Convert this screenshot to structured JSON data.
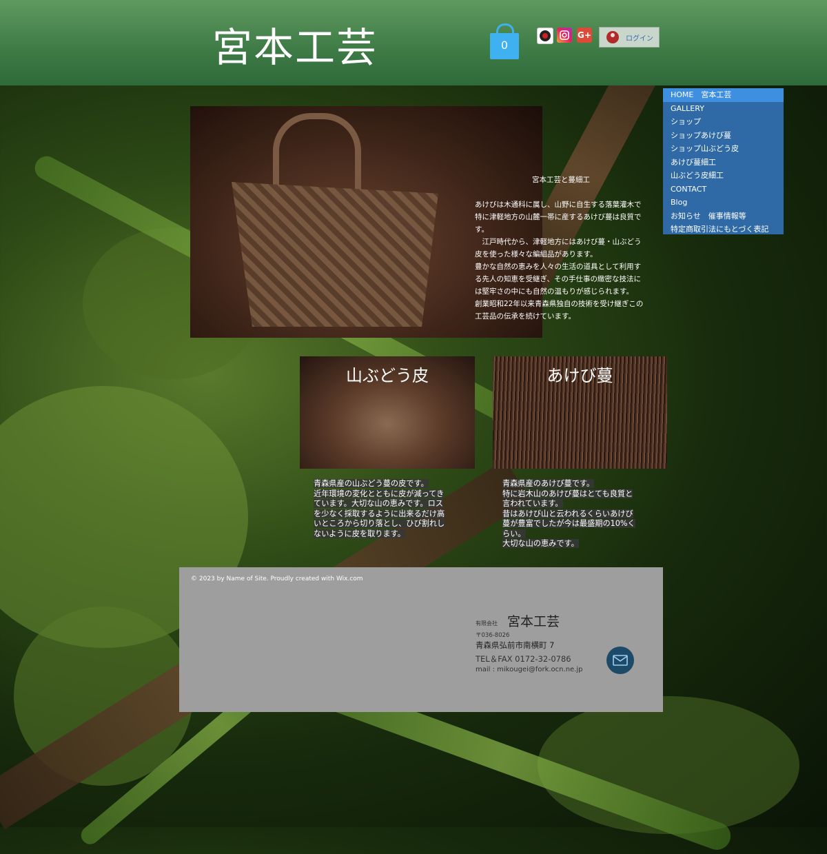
{
  "header": {
    "site_title": "宮本工芸",
    "cart_count": "0",
    "social_icons": [
      "blog-logo-icon",
      "instagram-icon",
      "google-plus-icon"
    ],
    "google_plus_label": "G+",
    "login_label": "ログイン"
  },
  "menu": {
    "items": [
      {
        "label": "HOME　宮本工芸",
        "active": true
      },
      {
        "label": "GALLERY"
      },
      {
        "label": "ショップ"
      },
      {
        "label": "ショップあけび蔓"
      },
      {
        "label": "ショップ山ぶどう皮"
      },
      {
        "label": "あけび蔓細工"
      },
      {
        "label": "山ぶどう皮細工"
      },
      {
        "label": "CONTACT"
      },
      {
        "label": "Blog"
      },
      {
        "label": "お知らせ　催事情報等"
      },
      {
        "label": "特定商取引法にもとづく表記"
      }
    ]
  },
  "intro": {
    "title": "宮本工芸と蔓細工",
    "paragraphs": [
      "あけびは木通科に属し、山野に自生する落葉灌木で特に津軽地方の山麓一帯に産するあけび蔓は良質です。",
      "　江戸時代から、津軽地方にはあけび蔓・山ぶどう皮を使った様々な編組品があります。",
      "豊かな自然の恵みを人々の生活の道具として利用する先人の知恵を受継ぎ、その手仕事の緻密な技法には堅牢さの中にも自然の温もりが感じられます。",
      "創業昭和22年以来青森県独自の技術を受け継ぎこの工芸品の伝承を続けています。"
    ]
  },
  "cards": [
    {
      "title": "山ぶどう皮",
      "lines": [
        "青森県産の山ぶどう蔓の皮です。",
        "近年環境の変化とともに皮が減ってき",
        "ています。大切な山の恵みです。ロス",
        "を少なく採取するように出来るだけ高",
        "いところから切り落とし、ひび割れし",
        "ないように皮を取ります。"
      ]
    },
    {
      "title": "あけび蔓",
      "lines": [
        "青森県産のあけび蔓です。",
        "特に岩木山のあけび蔓はとても良質と",
        "言われています。",
        "昔はあけび山と云われるくらいあけび",
        "蔓が豊富でしたが今は最盛期の10%く",
        "らい。",
        "大切な山の恵みです。"
      ]
    }
  ],
  "footer": {
    "copyright": "© 2023 by Name of Site. Proudly created with Wix.com",
    "company_prefix": "有限会社",
    "company_name": "宮本工芸",
    "postal": "〒036-8026",
    "address": "青森県弘前市南横町 7",
    "tel": "TEL＆FAX 0172-32-0786",
    "mail": "mail : mikougei@fork.ocn.ne.jp"
  },
  "colors": {
    "header_green": "#3d7a45",
    "cart_blue": "#3fb0f0",
    "menu_blue": "#2f6aa6",
    "menu_active": "#3f8fe0",
    "footer_gray": "#9e9e9e",
    "mail_button": "#1d4a68"
  }
}
